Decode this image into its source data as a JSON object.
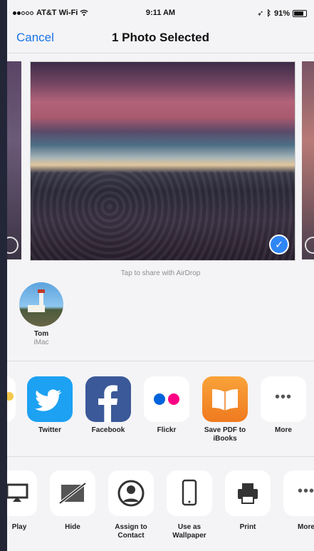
{
  "status_bar": {
    "carrier": "AT&T Wi-Fi",
    "time": "9:11 AM",
    "battery": "91%"
  },
  "nav": {
    "cancel_label": "Cancel",
    "title": "1 Photo Selected"
  },
  "airdrop_hint": "Tap to share with AirDrop",
  "contact": {
    "name": "Tom",
    "device": "iMac"
  },
  "apps": [
    {
      "label": "Twitter"
    },
    {
      "label": "Facebook"
    },
    {
      "label": "Flickr"
    },
    {
      "label": "Save PDF to",
      "label2": "iBooks"
    },
    {
      "label": "More"
    }
  ],
  "actions": [
    {
      "label": "Play"
    },
    {
      "label": "Hide"
    },
    {
      "label": "Assign to",
      "label2": "Contact"
    },
    {
      "label": "Use as",
      "label2": "Wallpaper"
    },
    {
      "label": "Print"
    },
    {
      "label": "More"
    }
  ],
  "colors": {
    "accent": "#1a73e8",
    "check_blue": "#2f86f5",
    "twitter": "#1da1f2",
    "facebook": "#3b5998",
    "ibooks": "#f58f2a"
  }
}
